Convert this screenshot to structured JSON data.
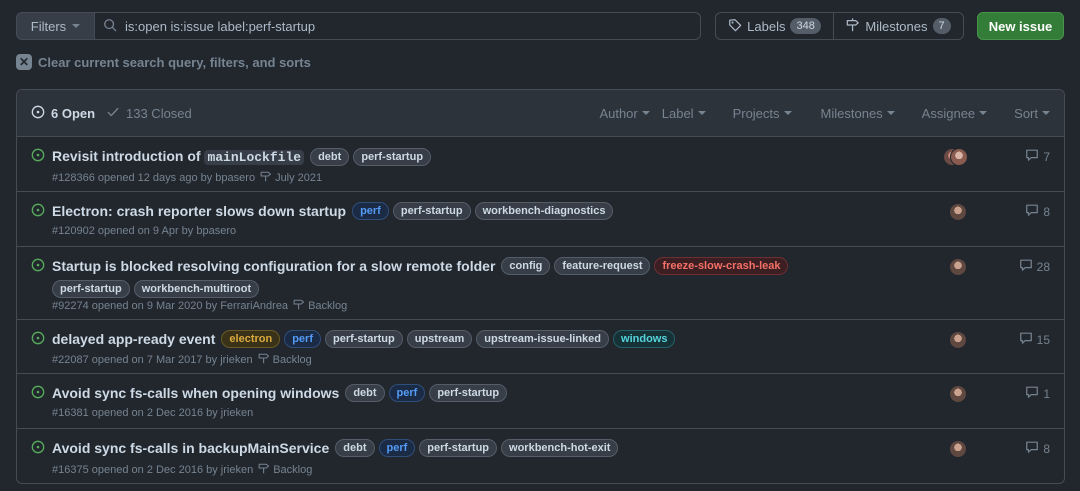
{
  "toolbar": {
    "filters_label": "Filters",
    "search_value": "is:open is:issue label:perf-startup",
    "labels_label": "Labels",
    "labels_count": "348",
    "milestones_label": "Milestones",
    "milestones_count": "7",
    "new_issue_label": "New issue"
  },
  "clear_label": "Clear current search query, filters, and sorts",
  "header": {
    "open_label": "6 Open",
    "closed_label": "133 Closed",
    "filters": [
      "Author",
      "Label",
      "Projects",
      "Milestones",
      "Assignee",
      "Sort"
    ]
  },
  "colors": {
    "open_green": "#57ab5a",
    "new_issue_bg": "#347d39"
  },
  "issues": [
    {
      "title": "Revisit introduction of",
      "title_code": "mainLockfile",
      "labels": [
        {
          "name": "debt",
          "style": "gray"
        },
        {
          "name": "perf-startup",
          "style": "gray"
        }
      ],
      "meta": "#128366 opened 12 days ago by bpasero",
      "milestone": "July 2021",
      "comments": "7",
      "avatars": [
        "multi"
      ]
    },
    {
      "title": "Electron: crash reporter slows down startup",
      "labels": [
        {
          "name": "perf",
          "style": "blue"
        },
        {
          "name": "perf-startup",
          "style": "gray"
        },
        {
          "name": "workbench-diagnostics",
          "style": "gray"
        }
      ],
      "meta": "#120902 opened on 9 Apr by bpasero",
      "milestone": "",
      "comments": "8",
      "avatars": [
        "single"
      ]
    },
    {
      "title": "Startup is blocked resolving configuration for a slow remote folder",
      "labels": [
        {
          "name": "config",
          "style": "gray"
        },
        {
          "name": "feature-request",
          "style": "gray"
        },
        {
          "name": "freeze-slow-crash-leak",
          "style": "red"
        },
        {
          "name": "perf-startup",
          "style": "gray"
        },
        {
          "name": "workbench-multiroot",
          "style": "gray"
        }
      ],
      "meta": "#92274 opened on 9 Mar 2020 by FerrariAndrea",
      "milestone": "Backlog",
      "comments": "28",
      "avatars": [
        "single"
      ]
    },
    {
      "title": "delayed app-ready event",
      "labels": [
        {
          "name": "electron",
          "style": "yellow"
        },
        {
          "name": "perf",
          "style": "blue"
        },
        {
          "name": "perf-startup",
          "style": "gray"
        },
        {
          "name": "upstream",
          "style": "gray"
        },
        {
          "name": "upstream-issue-linked",
          "style": "gray"
        },
        {
          "name": "windows",
          "style": "cyan"
        }
      ],
      "meta": "#22087 opened on 7 Mar 2017 by jrieken",
      "milestone": "Backlog",
      "comments": "15",
      "avatars": [
        "single"
      ]
    },
    {
      "title": "Avoid sync fs-calls when opening windows",
      "labels": [
        {
          "name": "debt",
          "style": "gray"
        },
        {
          "name": "perf",
          "style": "blue"
        },
        {
          "name": "perf-startup",
          "style": "gray"
        }
      ],
      "meta": "#16381 opened on 2 Dec 2016 by jrieken",
      "milestone": "",
      "comments": "1",
      "avatars": [
        "single"
      ]
    },
    {
      "title": "Avoid sync fs-calls in backupMainService",
      "labels": [
        {
          "name": "debt",
          "style": "gray"
        },
        {
          "name": "perf",
          "style": "blue"
        },
        {
          "name": "perf-startup",
          "style": "gray"
        },
        {
          "name": "workbench-hot-exit",
          "style": "gray"
        }
      ],
      "meta": "#16375 opened on 2 Dec 2016 by jrieken",
      "milestone": "Backlog",
      "comments": "8",
      "avatars": [
        "single"
      ]
    }
  ]
}
